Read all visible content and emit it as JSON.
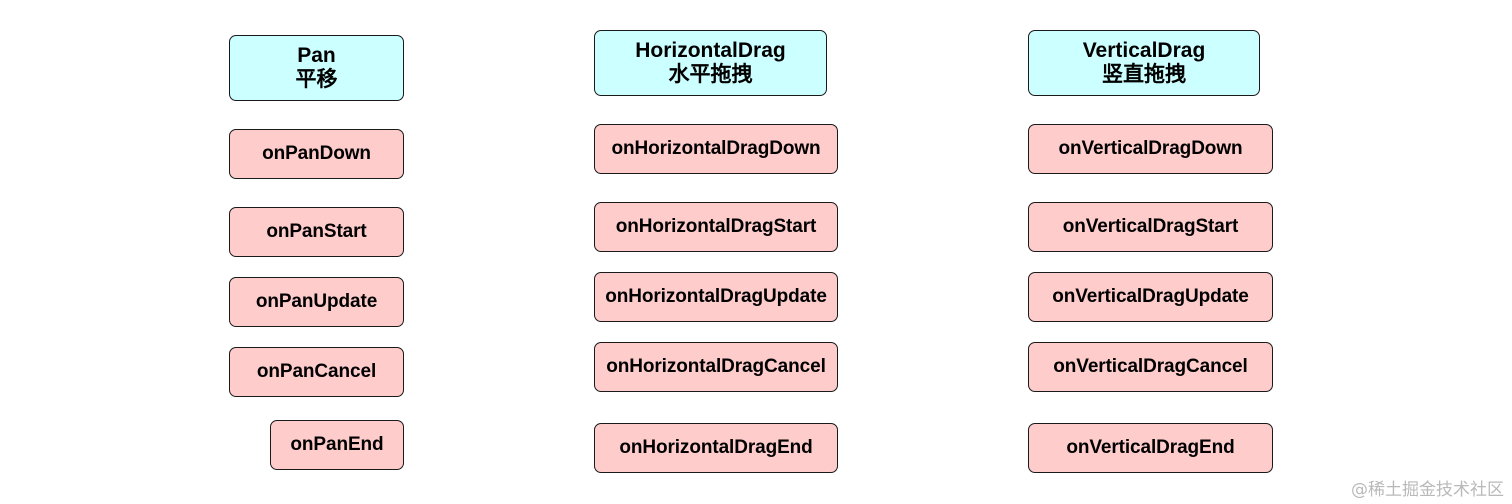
{
  "columns": {
    "pan": {
      "title": "Pan",
      "subtitle": "平移",
      "events": [
        "onPanDown",
        "onPanStart",
        "onPanUpdate",
        "onPanCancel",
        "onPanEnd"
      ]
    },
    "horizontal": {
      "title": "HorizontalDrag",
      "subtitle": "水平拖拽",
      "events": [
        "onHorizontalDragDown",
        "onHorizontalDragStart",
        "onHorizontalDragUpdate",
        "onHorizontalDragCancel",
        "onHorizontalDragEnd"
      ]
    },
    "vertical": {
      "title": "VerticalDrag",
      "subtitle": "竖直拖拽",
      "events": [
        "onVerticalDragDown",
        "onVerticalDragStart",
        "onVerticalDragUpdate",
        "onVerticalDragCancel",
        "onVerticalDragEnd"
      ]
    }
  },
  "watermark": "@稀土掘金技术社区",
  "colors": {
    "header_fill": "#ccffff",
    "event_fill": "#ffcccc",
    "border": "#1a1a1a"
  }
}
